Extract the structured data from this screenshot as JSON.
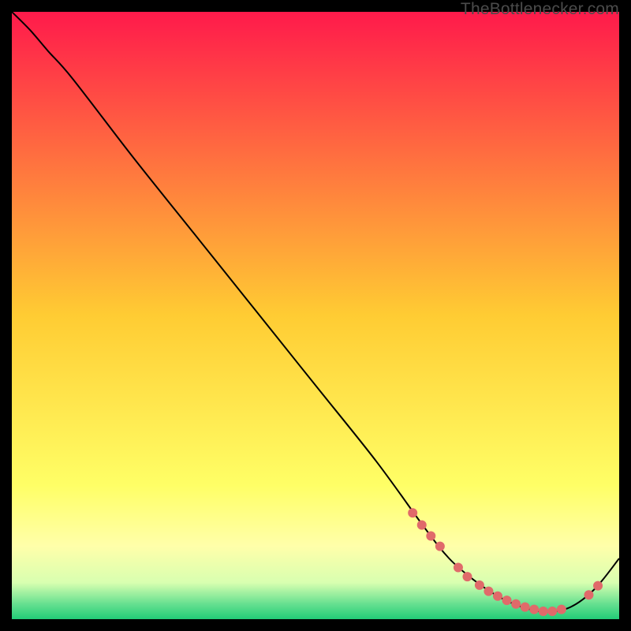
{
  "watermark": "TheBottlenecker.com",
  "chart_data": {
    "type": "line",
    "title": "",
    "xlabel": "",
    "ylabel": "",
    "xlim": [
      0,
      100
    ],
    "ylim": [
      0,
      100
    ],
    "grid": false,
    "legend": false,
    "background_gradient": {
      "stops": [
        {
          "offset": 0.0,
          "color": "#ff1a4b"
        },
        {
          "offset": 0.5,
          "color": "#ffcc33"
        },
        {
          "offset": 0.78,
          "color": "#ffff66"
        },
        {
          "offset": 0.88,
          "color": "#ffffaa"
        },
        {
          "offset": 0.94,
          "color": "#d8ffb0"
        },
        {
          "offset": 0.975,
          "color": "#66e090"
        },
        {
          "offset": 1.0,
          "color": "#22cc77"
        }
      ]
    },
    "series": [
      {
        "name": "curve",
        "color": "#000000",
        "stroke_width": 2,
        "x": [
          0,
          3,
          6,
          10,
          20,
          30,
          40,
          50,
          60,
          68,
          72,
          76,
          80,
          84,
          88,
          92,
          96,
          100
        ],
        "y": [
          100,
          97,
          93.5,
          89,
          76,
          63.5,
          51,
          38.5,
          26,
          15,
          10,
          6.5,
          3.8,
          2.0,
          1.2,
          2.0,
          5.0,
          10
        ]
      }
    ],
    "markers": {
      "color": "#e06a6a",
      "radius": 6,
      "points": [
        {
          "x": 66,
          "y": 17.5
        },
        {
          "x": 67.5,
          "y": 15.5
        },
        {
          "x": 69,
          "y": 13.7
        },
        {
          "x": 70.5,
          "y": 12
        },
        {
          "x": 73.5,
          "y": 8.5
        },
        {
          "x": 75,
          "y": 7
        },
        {
          "x": 77,
          "y": 5.6
        },
        {
          "x": 78.5,
          "y": 4.6
        },
        {
          "x": 80,
          "y": 3.8
        },
        {
          "x": 81.5,
          "y": 3.1
        },
        {
          "x": 83,
          "y": 2.5
        },
        {
          "x": 84.5,
          "y": 2.0
        },
        {
          "x": 86,
          "y": 1.6
        },
        {
          "x": 87.5,
          "y": 1.3
        },
        {
          "x": 89,
          "y": 1.3
        },
        {
          "x": 90.5,
          "y": 1.6
        },
        {
          "x": 95,
          "y": 4.0
        },
        {
          "x": 96.5,
          "y": 5.5
        }
      ]
    }
  }
}
